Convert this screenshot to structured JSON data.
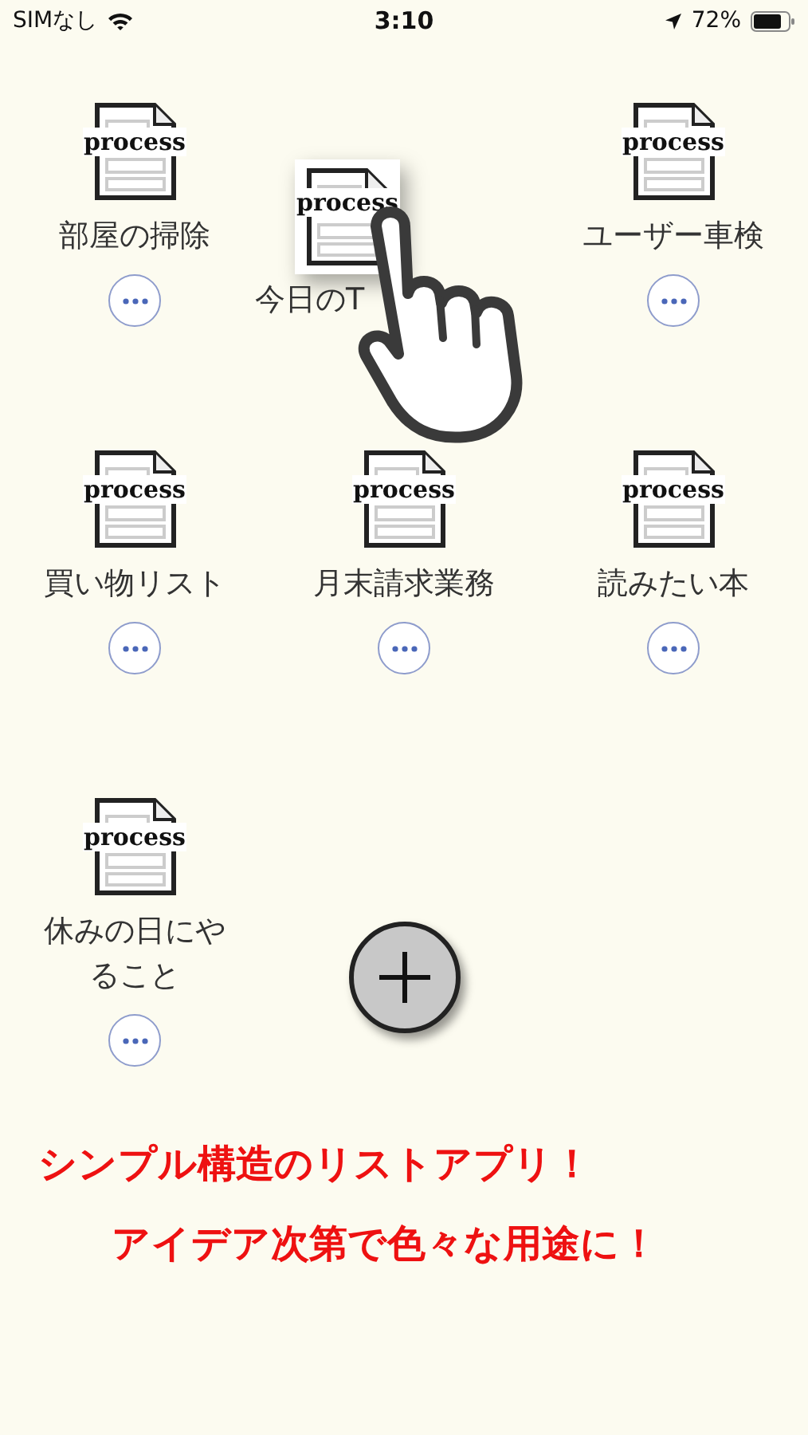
{
  "status_bar": {
    "carrier": "SIMなし",
    "time": "3:10",
    "battery": "72%"
  },
  "items": [
    {
      "icon_label": "process",
      "title": "部屋の掃除",
      "kind": "item"
    },
    {
      "kind": "empty"
    },
    {
      "icon_label": "process",
      "title": "ユーザー車検",
      "kind": "item"
    },
    {
      "icon_label": "process",
      "title": "買い物リスト",
      "kind": "item"
    },
    {
      "icon_label": "process",
      "title": "月末請求業務",
      "kind": "item"
    },
    {
      "icon_label": "process",
      "title": "読みたい本",
      "kind": "item"
    },
    {
      "icon_label": "process",
      "title": "休みの日にやること",
      "kind": "item"
    },
    {
      "kind": "add"
    }
  ],
  "dragging": {
    "icon_label": "process",
    "title": "今日のT"
  },
  "captions": [
    "シンプル構造のリストアプリ！",
    "アイデア次第で色々な用途に！"
  ]
}
